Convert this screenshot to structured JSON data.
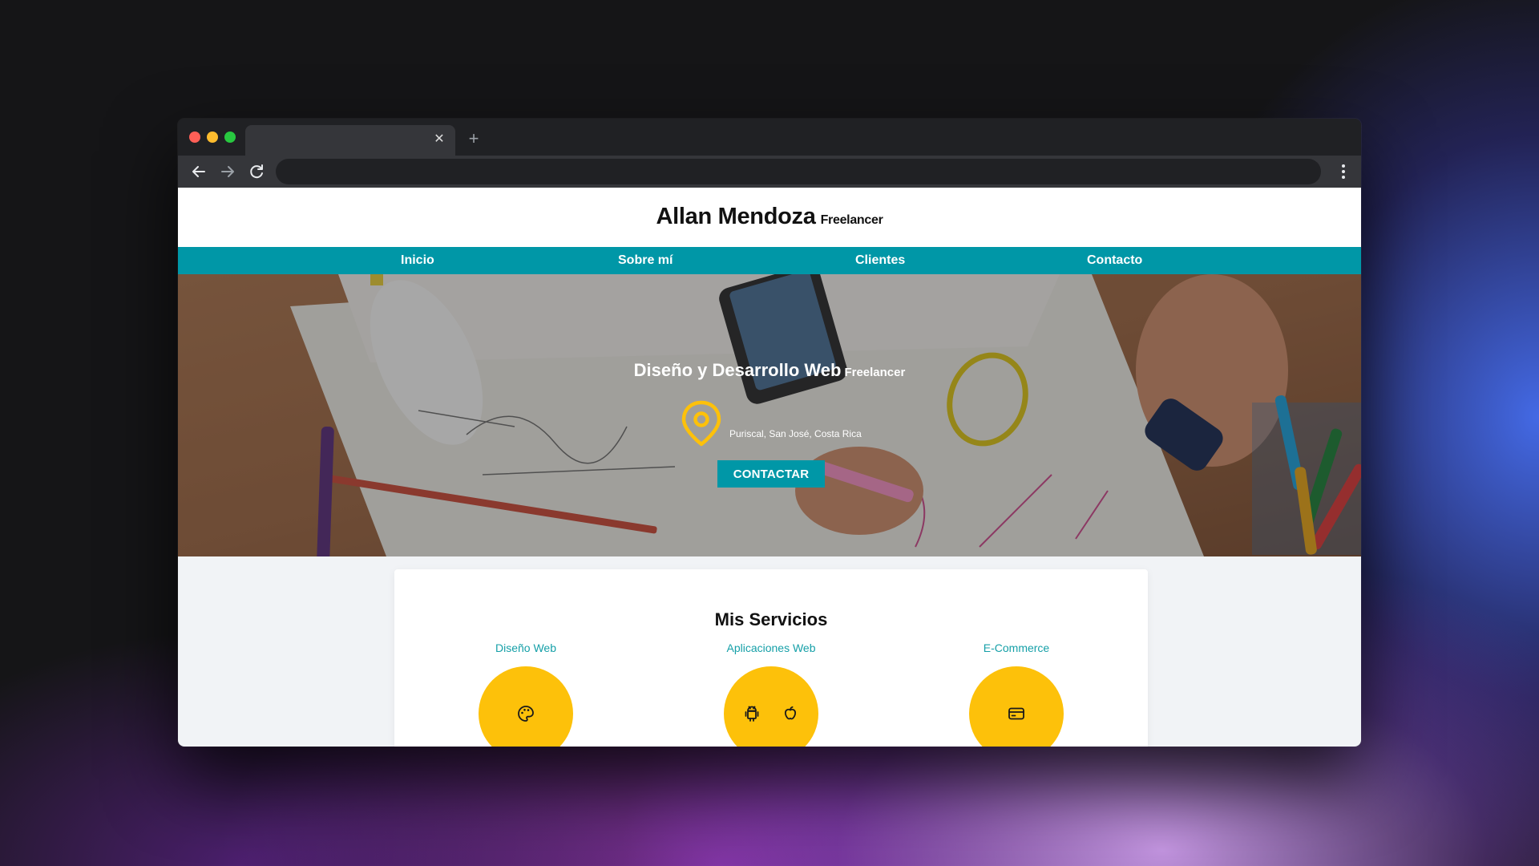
{
  "site": {
    "title": "Allan Mendoza",
    "subtitle": "Freelancer"
  },
  "nav": {
    "items": [
      {
        "label": "Inicio"
      },
      {
        "label": "Sobre mí"
      },
      {
        "label": "Clientes"
      },
      {
        "label": "Contacto"
      }
    ]
  },
  "hero": {
    "title": "Diseño y Desarrollo Web",
    "title_sub": "Freelancer",
    "location": "Puriscal, San José, Costa Rica",
    "cta_label": "CONTACTAR"
  },
  "services": {
    "title": "Mis Servicios",
    "items": [
      {
        "label": "Diseño Web",
        "icon": "palette-icon"
      },
      {
        "label": "Aplicaciones Web",
        "icon": "android-apple-icons"
      },
      {
        "label": "E-Commerce",
        "icon": "credit-card-icon"
      }
    ]
  },
  "colors": {
    "nav": "#0097a7",
    "accent_yellow": "#fdc10a",
    "service_label": "#16a0a8"
  }
}
